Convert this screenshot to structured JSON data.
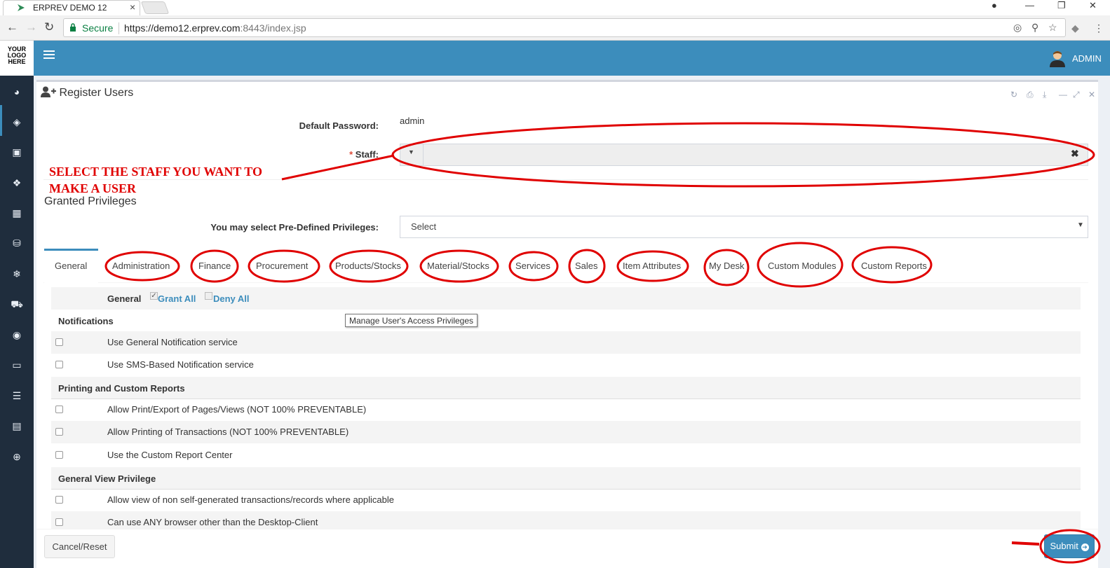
{
  "browser": {
    "tab_title": "ERPREV DEMO 12",
    "tab_close": "×",
    "secure_label": "Secure",
    "url_prefix": "https://demo12.erprev.com",
    "url_rest": ":8443/index.jsp"
  },
  "logo_text": [
    "YOUR",
    "LOGO",
    "HERE"
  ],
  "topbar": {
    "user_label": "ADMIN"
  },
  "page": {
    "title": "Register Users",
    "default_password_label": "Default Password:",
    "default_password_value": "admin",
    "staff_required": "*",
    "staff_label": "Staff:",
    "staff_clear": "✖",
    "annotation_line1": "SELECT THE STAFF YOU WANT TO",
    "annotation_line2": "MAKE A USER",
    "granted_title": "Granted Privileges",
    "predefined_label": "You may select Pre-Defined Privileges:",
    "predefined_value": "Select",
    "tooltip": "Manage User's Access Privileges"
  },
  "tabs": [
    "General",
    "Administration",
    "Finance",
    "Procurement",
    "Products/Stocks",
    "Material/Stocks",
    "Services",
    "Sales",
    "Item Attributes",
    "My Desk",
    "Custom Modules",
    "Custom Reports"
  ],
  "grant_bar": {
    "section": "General",
    "grant_all": "Grant All",
    "deny_all": "Deny All"
  },
  "privileges": {
    "notifications_head": "Notifications",
    "n1": "Use General Notification service",
    "n2": "Use SMS-Based Notification service",
    "printing_head": "Printing and Custom Reports",
    "p1": "Allow Print/Export of Pages/Views (NOT 100% PREVENTABLE)",
    "p2": "Allow Printing of Transactions (NOT 100% PREVENTABLE)",
    "p3": "Use the Custom Report Center",
    "view_head": "General View Privilege",
    "v1": "Allow view of non self-generated transactions/records where applicable",
    "v2": "Can use ANY browser other than the Desktop-Client"
  },
  "footer": {
    "cancel": "Cancel/Reset",
    "submit": "Submit"
  },
  "colors": {
    "primary": "#3c8dbc",
    "sidebar": "#1f2d3d",
    "annotation": "#e00000"
  },
  "icons": {
    "sidebar": [
      "dashboard-icon",
      "tag-icon",
      "money-icon",
      "cubes-icon",
      "building-icon",
      "database-icon",
      "snowflake-icon",
      "cart-icon",
      "spotify-like-icon",
      "desktop-icon",
      "server-icon",
      "book-icon",
      "lifebuoy-icon"
    ]
  }
}
